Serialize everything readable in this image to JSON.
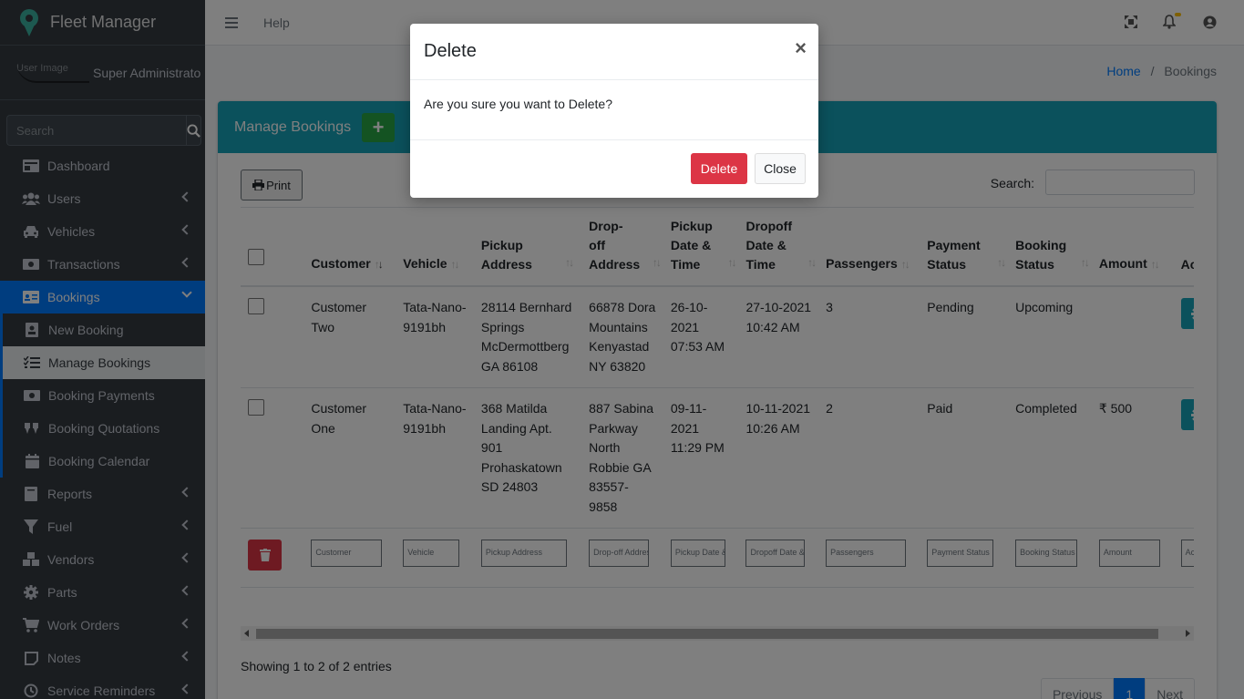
{
  "app": {
    "title": "Fleet Manager",
    "user_img_alt": "User Image",
    "user_name": "Super Administrato"
  },
  "sidebar": {
    "search_placeholder": "Search",
    "items": [
      {
        "label": "Dashboard",
        "icon": "dashboard-icon"
      },
      {
        "label": "Users",
        "icon": "users-icon"
      },
      {
        "label": "Vehicles",
        "icon": "car-icon"
      },
      {
        "label": "Transactions",
        "icon": "money-icon"
      },
      {
        "label": "Bookings",
        "icon": "id-card-icon"
      },
      {
        "label": "Reports",
        "icon": "book-icon"
      },
      {
        "label": "Fuel",
        "icon": "filter-icon"
      },
      {
        "label": "Vendors",
        "icon": "cubes-icon"
      },
      {
        "label": "Parts",
        "icon": "gear-icon"
      },
      {
        "label": "Work Orders",
        "icon": "cart-icon"
      },
      {
        "label": "Notes",
        "icon": "note-icon"
      },
      {
        "label": "Service Reminders",
        "icon": "history-icon"
      }
    ],
    "booking_sub": [
      {
        "label": "New Booking"
      },
      {
        "label": "Manage Bookings"
      },
      {
        "label": "Booking Payments"
      },
      {
        "label": "Booking Quotations"
      },
      {
        "label": "Booking Calendar"
      }
    ]
  },
  "topbar": {
    "help": "Help"
  },
  "breadcrumb": {
    "home": "Home",
    "sep": "/",
    "current": "Bookings"
  },
  "card": {
    "title": "Manage Bookings",
    "add": "+",
    "print": "Print",
    "search_label": "Search:"
  },
  "table": {
    "columns": [
      "Customer",
      "Vehicle",
      "Pickup Address",
      "Drop-off Address",
      "Pickup Date & Time",
      "Dropoff Date & Time",
      "Passengers",
      "Payment Status",
      "Booking Status",
      "Amount",
      "Action"
    ],
    "rows": [
      {
        "customer": "Customer Two",
        "vehicle": "Tata-Nano-9191bh",
        "pickup": "28114 Bernhard Springs McDermottberg GA 86108",
        "dropoff": "66878 Dora Mountains Kenyastad NY 63820",
        "pickup_dt": "26-10-2021 07:53 AM",
        "dropoff_dt": "27-10-2021 10:42 AM",
        "passengers": "3",
        "payment": "Pending",
        "status": "Upcoming",
        "amount": ""
      },
      {
        "customer": "Customer One",
        "vehicle": "Tata-Nano-9191bh",
        "pickup": "368 Matilda Landing Apt. 901 Prohaskatown SD 24803",
        "dropoff": "887 Sabina Parkway North Robbie GA 83557-9858",
        "pickup_dt": "09-11-2021 11:29 PM",
        "dropoff_dt": "10-11-2021 10:26 AM",
        "passengers": "2",
        "payment": "Paid",
        "status": "Completed",
        "amount": "₹ 500"
      }
    ],
    "filters": [
      "Customer",
      "Vehicle",
      "Pickup Address",
      "Drop-off Addres",
      "Pickup Date &",
      "Dropoff Date &",
      "Passengers",
      "Payment Status",
      "Booking Status",
      "Amount",
      "Action"
    ]
  },
  "footer": {
    "info": "Showing 1 to 2 of 2 entries",
    "prev": "Previous",
    "page": "1",
    "next": "Next"
  },
  "modal": {
    "title": "Delete",
    "close": "×",
    "body": "Are you sure you want to Delete?",
    "delete": "Delete",
    "cancel": "Close"
  }
}
